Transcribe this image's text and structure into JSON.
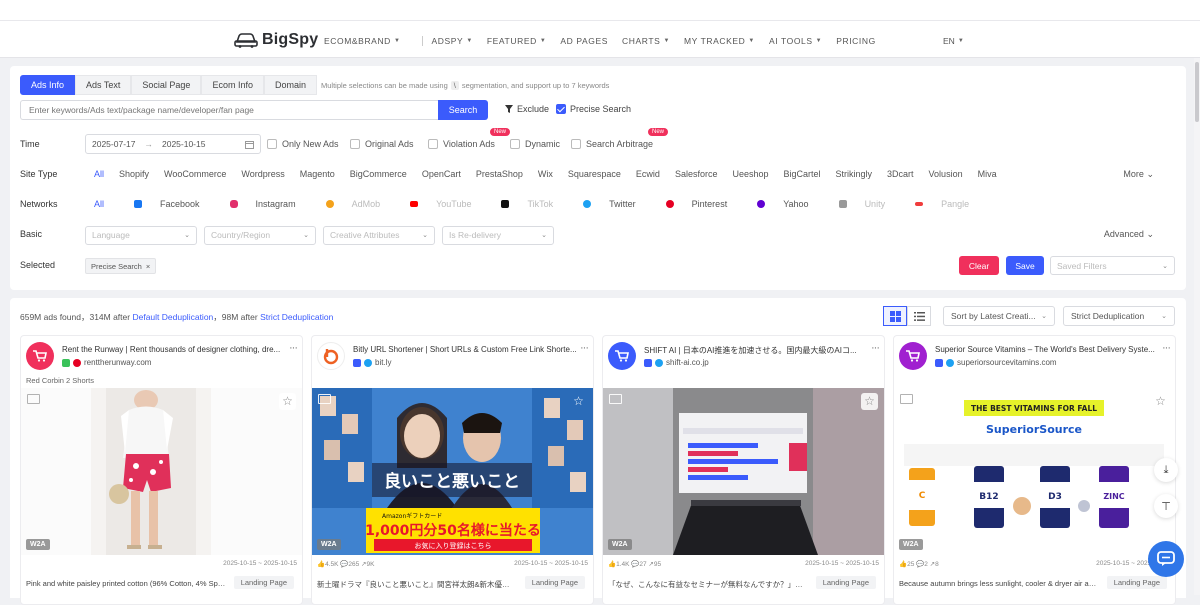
{
  "brand": {
    "name": "BigSpy"
  },
  "nav": {
    "items": [
      {
        "label": "ECOM&BRAND",
        "dropdown": true
      },
      {
        "label": "ADSPY",
        "dropdown": true
      },
      {
        "label": "FEATURED",
        "dropdown": true
      },
      {
        "label": "AD PAGES",
        "dropdown": false
      },
      {
        "label": "CHARTS",
        "dropdown": true
      },
      {
        "label": "MY TRACKED",
        "dropdown": true
      },
      {
        "label": "AI TOOLS",
        "dropdown": true
      },
      {
        "label": "PRICING",
        "dropdown": false
      }
    ],
    "lang": "EN"
  },
  "search": {
    "tabs": [
      "Ads Info",
      "Ads Text",
      "Social Page",
      "Ecom Info",
      "Domain"
    ],
    "hint_before": "Multiple selections can be made using",
    "hint_key": "\\",
    "hint_after": "segmentation, and support up to 7 keywords",
    "placeholder": "Enter keywords/Ads text/package name/developer/fan page",
    "button": "Search",
    "exclude": "Exclude",
    "precise": "Precise Search"
  },
  "filters": {
    "time_label": "Time",
    "date_start": "2025-07-17",
    "date_end": "2025-10-15",
    "date_sep": "→",
    "checks": [
      "Only New Ads",
      "Original Ads",
      "Violation Ads",
      "Dynamic",
      "Search Arbitrage"
    ],
    "new_badge": "New",
    "site_type_label": "Site Type",
    "site_types": [
      "All",
      "Shopify",
      "WooCommerce",
      "Wordpress",
      "Magento",
      "BigCommerce",
      "OpenCart",
      "PrestaShop",
      "Wix",
      "Squarespace",
      "Ecwid",
      "Salesforce",
      "Ueeshop",
      "BigCartel",
      "Strikingly",
      "3Dcart",
      "Volusion",
      "Miva"
    ],
    "more": "More",
    "networks_label": "Networks",
    "networks": [
      {
        "name": "All",
        "color": "#3b5bfc",
        "enabled": true
      },
      {
        "name": "Facebook",
        "color": "#1877f2",
        "enabled": true
      },
      {
        "name": "Instagram",
        "color": "#e1306c",
        "enabled": true
      },
      {
        "name": "AdMob",
        "color": "#f4a21b",
        "enabled": false
      },
      {
        "name": "YouTube",
        "color": "#ff0000",
        "enabled": false
      },
      {
        "name": "TikTok",
        "color": "#111111",
        "enabled": false
      },
      {
        "name": "Twitter",
        "color": "#1da1f2",
        "enabled": true
      },
      {
        "name": "Pinterest",
        "color": "#e60023",
        "enabled": true
      },
      {
        "name": "Yahoo",
        "color": "#6001d2",
        "enabled": true
      },
      {
        "name": "Unity",
        "color": "#999999",
        "enabled": false
      },
      {
        "name": "Pangle",
        "color": "#f03c3c",
        "enabled": false
      }
    ],
    "basic_label": "Basic",
    "basic_selects": [
      "Language",
      "Country/Region",
      "Creative Attributes",
      "Is Re-delivery"
    ],
    "advanced": "Advanced",
    "selected_label": "Selected",
    "selected_chip": "Precise Search",
    "clear": "Clear",
    "save": "Save",
    "saved_filters": "Saved Filters"
  },
  "results": {
    "count_text": "659M ads found，314M after",
    "default_dedup": "Default Deduplication",
    "mid_text": "，98M after",
    "strict_dedup_link": "Strict Deduplication",
    "sort": "Sort by Latest Creati...",
    "dedup_select": "Strict Deduplication"
  },
  "cards": [
    {
      "title": "Rent the Runway | Rent thousands of designer clothing, dre...",
      "domain": "renttherunway.com",
      "avatar_color": "#f0305c",
      "sub": "Red Corbin 2 Shorts",
      "badge": "W2A",
      "likes": "",
      "comments": "",
      "shares": "",
      "date": "2025-10-15 ~ 2025-10-15",
      "footer": "Pink and white paisley printed cotton (96% Cotton, 4% Span...",
      "cta": "Landing Page"
    },
    {
      "title": "Bitly URL Shortener | Short URLs & Custom Free Link Shorte...",
      "domain": "bit.ly",
      "avatar_color": "#ffffff",
      "sub": "",
      "badge": "W2A",
      "likes": "4.5K",
      "comments": "265",
      "shares": "9K",
      "date": "2025-10-15 ~ 2025-10-15",
      "footer": "新土曜ドラマ『良いこと悪いこと』間宮祥太朗&新木優子 1...",
      "cta": "Landing Page",
      "banner_small": "Amazonギフトカード",
      "banner_big": "1,000円分50名様に当たる",
      "banner_btn": "お気に入り登録はこちら",
      "banner_title": "良いこと悪いこと"
    },
    {
      "title": "SHIFT AI | 日本のAI推進を加速させる。国内最大級のAIコ...",
      "domain": "shift-ai.co.jp",
      "avatar_color": "#3b5bfc",
      "sub": "",
      "badge": "W2A",
      "likes": "1.4K",
      "comments": "27",
      "shares": "95",
      "date": "2025-10-15 ~ 2025-10-15",
      "footer": "「なぜ、こんなに有益なセミナーが無料なんですか？」と...",
      "cta": "Landing Page"
    },
    {
      "title": "Superior Source Vitamins – The World's Best Delivery Syste...",
      "domain": "superiorsourcevitamins.com",
      "avatar_color": "#a020d0",
      "sub": "",
      "badge": "W2A",
      "likes": "25",
      "comments": "2",
      "shares": "8",
      "date": "2025-10-15 ~ 2025-10-15",
      "footer": "Because autumn brings less sunlight, cooler & dryer air and ...",
      "cta": "Landing Page",
      "banner": "THE BEST VITAMINS FOR FALL",
      "brand_text": "SuperiorSource",
      "bottles": [
        "C",
        "B12",
        "D3",
        "ZINC"
      ]
    }
  ],
  "accent": "#3b5bfc",
  "danger": "#f0305c"
}
